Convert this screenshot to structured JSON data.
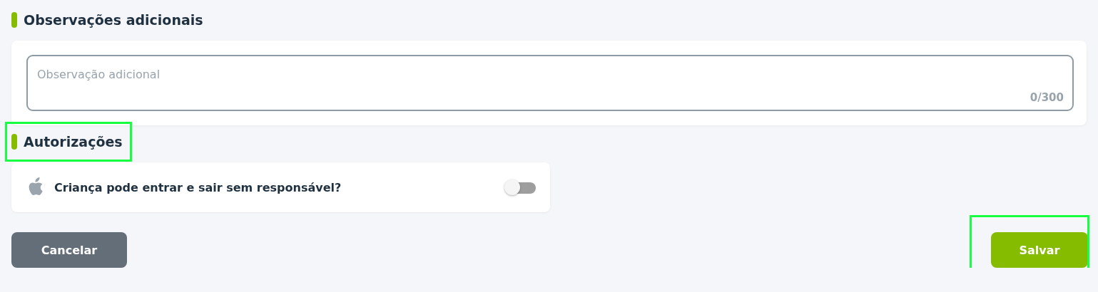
{
  "sections": [
    {
      "title": "Observações adicionais",
      "highlighted": false,
      "kind": "textarea",
      "placeholder": "Observação adicional",
      "counter": "0/300"
    },
    {
      "title": "Autorizações",
      "highlighted": true,
      "kind": "toggles",
      "items": [
        {
          "label": "Criança pode entrar e sair sem responsável?",
          "on": false
        }
      ]
    }
  ],
  "buttons": [
    {
      "label": "Cancelar",
      "kind": "secondary",
      "highlighted": false
    },
    {
      "label": "Salvar",
      "kind": "primary",
      "highlighted": true
    }
  ]
}
